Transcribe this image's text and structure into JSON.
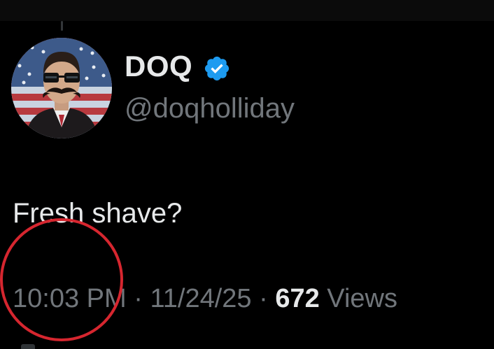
{
  "author": {
    "display_name": "DOQ",
    "handle": "@doqholliday",
    "verified": true
  },
  "tweet": {
    "text": "Fresh shave?",
    "time": "10:03 PM",
    "separator": " · ",
    "date": "11/24/25",
    "views_count": "672",
    "views_label": "Views"
  },
  "icons": {
    "verified_badge": "verified-check-icon"
  },
  "colors": {
    "background": "#000000",
    "primary_text": "#e7e9ea",
    "secondary_text": "#71767b",
    "verified_blue": "#1d9bf0",
    "annotation_red": "#d6262f"
  }
}
